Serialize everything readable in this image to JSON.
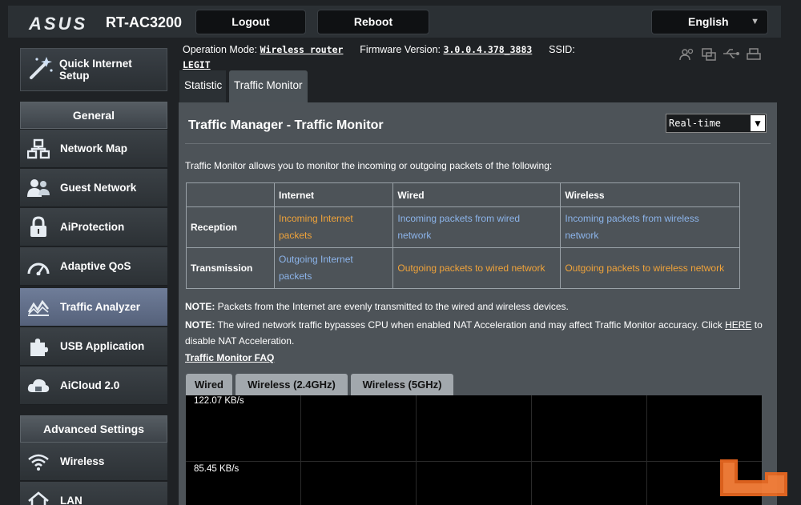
{
  "header": {
    "logo": "ASUS",
    "model": "RT-AC3200",
    "logout_label": "Logout",
    "reboot_label": "Reboot",
    "language": "English"
  },
  "sidebar": {
    "quick_setup": "Quick Internet Setup",
    "general_header": "General",
    "general_items": [
      {
        "label": "Network Map",
        "icon": "network-map-icon"
      },
      {
        "label": "Guest Network",
        "icon": "guest-network-icon"
      },
      {
        "label": "AiProtection",
        "icon": "lock-icon"
      },
      {
        "label": "Adaptive QoS",
        "icon": "gauge-icon"
      },
      {
        "label": "Traffic Analyzer",
        "icon": "traffic-chart-icon"
      },
      {
        "label": "USB Application",
        "icon": "puzzle-icon"
      },
      {
        "label": "AiCloud 2.0",
        "icon": "cloud-icon"
      }
    ],
    "advanced_header": "Advanced Settings",
    "advanced_items": [
      {
        "label": "Wireless",
        "icon": "wifi-icon"
      },
      {
        "label": "LAN",
        "icon": "house-icon"
      }
    ]
  },
  "status": {
    "op_mode_label": "Operation Mode:",
    "op_mode_value": "Wireless router",
    "fw_label": "Firmware Version:",
    "fw_value": "3.0.0.4.378_3883",
    "ssid_label": "SSID:",
    "ssid_value": "LEGIT"
  },
  "tabs": [
    "Statistic",
    "Traffic Monitor"
  ],
  "panel": {
    "title": "Traffic Manager - Traffic Monitor",
    "mode_select": "Real-time",
    "description": "Traffic Monitor allows you to monitor the incoming or outgoing packets of the following:",
    "table": {
      "headers": [
        "",
        "Internet",
        "Wired",
        "Wireless"
      ],
      "rows": [
        {
          "label": "Reception",
          "cells": [
            "Incoming Internet packets",
            "Incoming packets from wired network",
            "Incoming packets from wireless network"
          ]
        },
        {
          "label": "Transmission",
          "cells": [
            "Outgoing Internet packets",
            "Outgoing packets to wired network",
            "Outgoing packets to wireless network"
          ]
        }
      ]
    },
    "note1_label": "NOTE:",
    "note1_text": " Packets from the Internet are evenly transmitted to the wired and wireless devices.",
    "note2_label": "NOTE:",
    "note2_text_a": " The wired network traffic bypasses CPU when enabled NAT Acceleration and may affect Traffic Monitor accuracy. Click ",
    "note2_link": "HERE",
    "note2_text_b": " to disable NAT Acceleration.",
    "faq": "Traffic Monitor FAQ",
    "graph_tabs": [
      "Wired",
      "Wireless (2.4GHz)",
      "Wireless (5GHz)"
    ],
    "graph_labels": [
      "122.07 KB/s",
      "85.45 KB/s"
    ]
  },
  "colors": {
    "orange_text": "#f0a33a",
    "blue_text": "#8cb4ea",
    "active_nav": "#6f7d99"
  }
}
